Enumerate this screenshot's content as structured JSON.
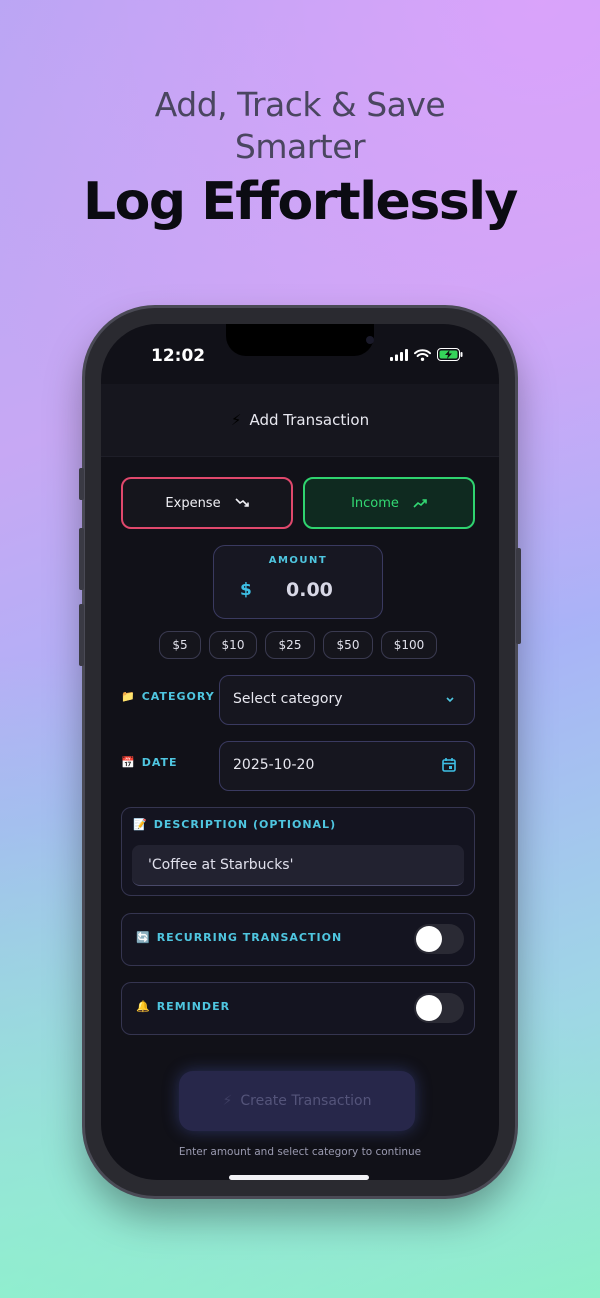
{
  "promo": {
    "subtitle_line1": "Add, Track & Save",
    "subtitle_line2": "Smarter",
    "title": "Log Effortlessly"
  },
  "status_bar": {
    "time": "12:02"
  },
  "nav": {
    "icon": "⚡",
    "title": "Add Transaction"
  },
  "type_toggle": {
    "expense_label": "Expense",
    "income_label": "Income",
    "selected": "Income",
    "colors": {
      "expense": "#e0486c",
      "income": "#2fd36f"
    }
  },
  "amount": {
    "label": "AMOUNT",
    "currency": "$",
    "value": "0.00"
  },
  "quick_amounts": [
    "$5",
    "$10",
    "$25",
    "$50",
    "$100"
  ],
  "category": {
    "icon": "📁",
    "label": "CATEGORY",
    "placeholder": "Select category"
  },
  "date": {
    "icon": "📅",
    "label": "DATE",
    "value": "2025-10-20"
  },
  "description": {
    "icon": "📝",
    "label": "DESCRIPTION (OPTIONAL)",
    "placeholder": "'Coffee at Starbucks'"
  },
  "recurring": {
    "icon": "🔄",
    "label": "RECURRING TRANSACTION",
    "enabled": false
  },
  "reminder": {
    "icon": "🔔",
    "label": "REMINDER",
    "enabled": false
  },
  "create_button": {
    "icon": "⚡",
    "label": "Create Transaction"
  },
  "hint": "Enter amount and select category to continue",
  "accent_color": "#4fc6e0"
}
